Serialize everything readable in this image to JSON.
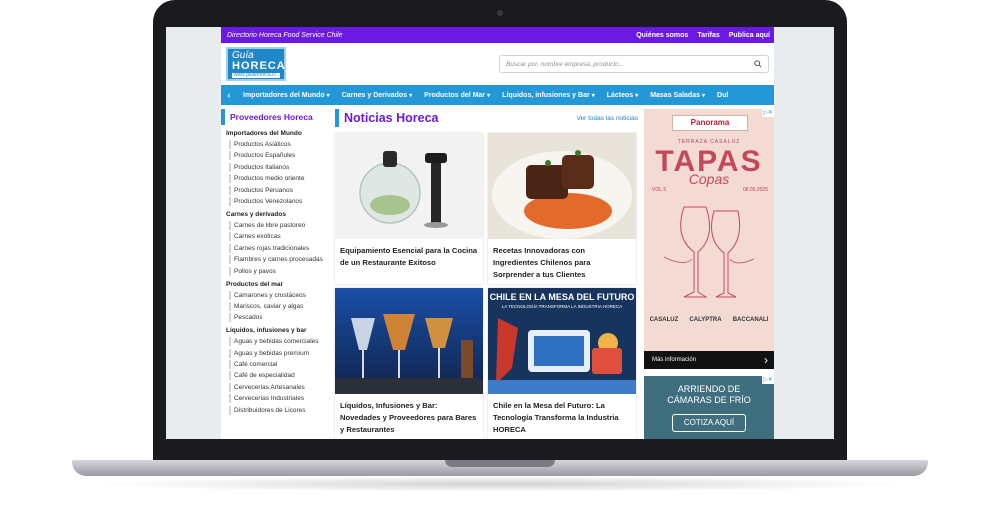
{
  "topbar": {
    "tagline": "Directorio Horeca Food Service Chile",
    "links": [
      "Quiénes somos",
      "Tarifas",
      "Publica aquí"
    ]
  },
  "logo": {
    "line1": "Guía",
    "line2": "HORECA",
    "line3": "www.guiahoreca.cl"
  },
  "search": {
    "placeholder": "Buscar por, nombre empresa, producto..."
  },
  "catnav": {
    "items": [
      "Importadores del Mundo",
      "Carnes y Derivados",
      "Productos del Mar",
      "Líquidos, infusiones y Bar",
      "Lácteos",
      "Masas Saladas",
      "Dul"
    ]
  },
  "sidebar": {
    "title": "Proveedores Horeca",
    "groups": [
      {
        "name": "Importadores del Mundo",
        "links": [
          "Productos Asiáticos",
          "Productos Españoles",
          "Productos Italianos",
          "Productos medio oriente",
          "Productos Peruanos",
          "Productos Venezolanos"
        ]
      },
      {
        "name": "Carnes y derivados",
        "links": [
          "Carnes de libre pastoreo",
          "Carnes exóticas",
          "Carnes rojas tradicionales",
          "Fiambres y carnes procesadas",
          "Pollos y pavos"
        ]
      },
      {
        "name": "Productos del mar",
        "links": [
          "Camarones y crustáceos",
          "Mariscos, caviar y algas",
          "Pescados"
        ]
      },
      {
        "name": "Líquidos, infusiones y bar",
        "links": [
          "Aguas y bebidas comerciales",
          "Aguas y bebidas premium",
          "Café comercial",
          "Café de especialidad",
          "Cervecerías Artesanales",
          "Cervecerías Industriales",
          "Distribuidores de Licores"
        ]
      }
    ]
  },
  "news": {
    "title": "Noticias Horeca",
    "see_all": "Ver todas las noticias",
    "cards": [
      {
        "title": "Equipamiento Esencial para la Cocina de un Restaurante Exitoso"
      },
      {
        "title": "Recetas Innovadoras con Ingredientes Chilenos para Sorprender a tus Clientes"
      },
      {
        "title": "Líquidos, Infusiones y Bar: Novedades y Proveedores para Bares y Restaurantes"
      },
      {
        "title": "Chile en la Mesa del Futuro: La Tecnología Transforma la Industria HORECA",
        "image_heading": "CHILE EN LA MESA DEL FUTURO",
        "image_sub": "LA TECNOLOGÍA TRANSFORMA LA INDUSTRIA HORECA"
      }
    ]
  },
  "ad1": {
    "badge": "Panorama",
    "terraza": "TERRAZA CASALUZ",
    "tapas": "TAPAS",
    "copas": "Copas",
    "vol": "VOL.5",
    "date": "08.05.2025",
    "sponsors": [
      "CASALUZ",
      "CALYPTRA",
      "BACCANALI"
    ],
    "more": "Más información"
  },
  "ad2": {
    "line1": "ARRIENDO DE",
    "line2": "CÁMARAS DE FRÍO",
    "cta": "COTIZA AQUÍ"
  },
  "colors": {
    "purple": "#6a1ae3",
    "blue": "#2497d7"
  }
}
